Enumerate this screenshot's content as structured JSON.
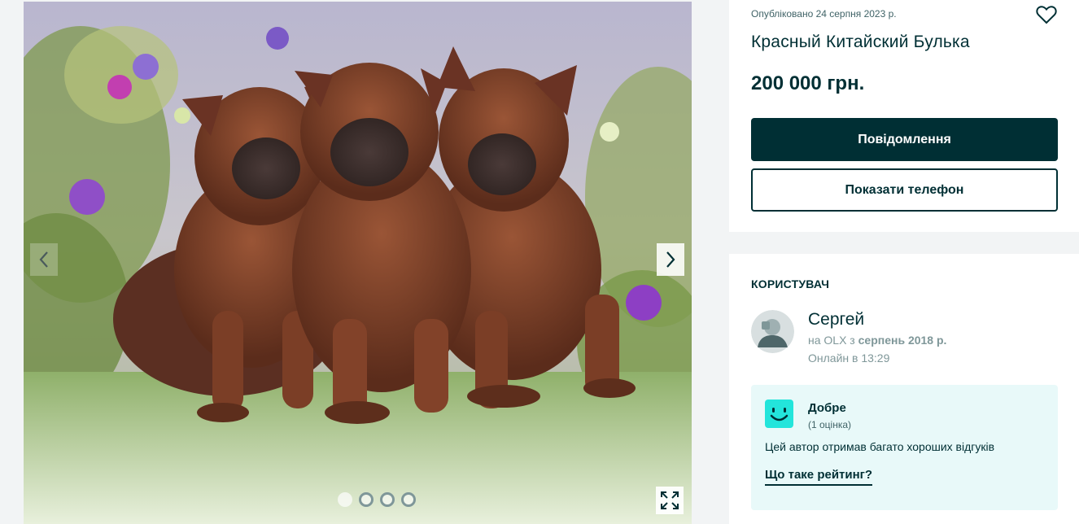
{
  "gallery": {
    "photo_alt": "three puppies",
    "dots_count": 4,
    "active_dot": 0
  },
  "ad": {
    "published": "Опубліковано 24 серпня 2023 р.",
    "title": "Красный Китайский Булька",
    "price": "200 000 грн.",
    "message_button": "Повідомлення",
    "phone_button": "Показати телефон"
  },
  "user": {
    "heading": "КОРИСТУВАЧ",
    "name": "Сергей",
    "since_prefix": "на OLX з ",
    "since_date": "серпень 2018 р.",
    "online": "Онлайн в 13:29"
  },
  "rating": {
    "label": "Добре",
    "count": "(1 оцінка)",
    "description": "Цей автор отримав багато хороших відгуків",
    "link": "Що таке рейтинг?"
  },
  "colors": {
    "primary": "#002f34",
    "rating_bg": "#e8f9f9",
    "smile": "#23e5db"
  }
}
